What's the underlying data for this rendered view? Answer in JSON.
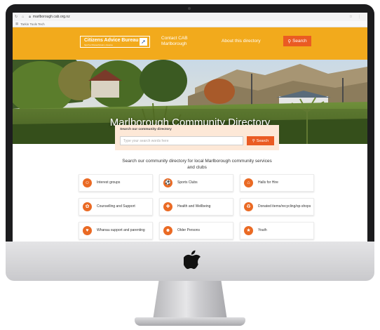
{
  "browser": {
    "url": "marlborough.cab.org.nz",
    "bookmark": "Tarkin Tools Tech"
  },
  "header": {
    "logo_text": "Citizens Advice Bureau",
    "logo_tagline": "Ngā Pou Whakawhirinaki o Aotearoa",
    "contact_line1": "Contact CAB",
    "contact_line2": "Marlborough",
    "about_label": "About this directory",
    "search_label": "Search"
  },
  "hero": {
    "title": "Marlborough Community Directory"
  },
  "search": {
    "label": "Search our community directory",
    "placeholder": "Type your search words here",
    "button_label": "Search"
  },
  "intro": {
    "text": "Search our community directory for local Marlborough community services and clubs"
  },
  "categories": [
    {
      "label": "Interest groups",
      "icon": "people-icon",
      "glyph": "☺"
    },
    {
      "label": "Sports Clubs",
      "icon": "ball-icon",
      "glyph": "⚽"
    },
    {
      "label": "Halls for Hire",
      "icon": "house-icon",
      "glyph": "⌂"
    },
    {
      "label": "Counselling and Support",
      "icon": "support-icon",
      "glyph": "✿"
    },
    {
      "label": "Health and Wellbeing",
      "icon": "medical-icon",
      "glyph": "✚"
    },
    {
      "label": "Donated items/recycling/op-shops",
      "icon": "recycle-icon",
      "glyph": "♻"
    },
    {
      "label": "Whanau support and parenting",
      "icon": "family-icon",
      "glyph": "♥"
    },
    {
      "label": "Older Persons",
      "icon": "person-icon",
      "glyph": "☻"
    },
    {
      "label": "Youth",
      "icon": "youth-icon",
      "glyph": "★"
    }
  ],
  "colors": {
    "header": "#f2aa1c",
    "accent": "#ea5b23",
    "panel": "#fde8d7"
  }
}
